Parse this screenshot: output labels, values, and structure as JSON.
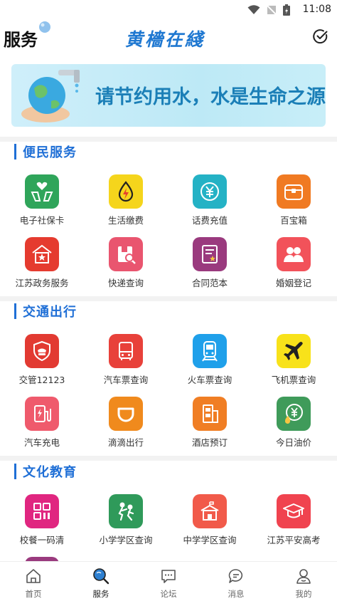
{
  "status_bar": {
    "time": "11:08"
  },
  "header": {
    "title": "服务",
    "brand": "黄檣在綫"
  },
  "banner": {
    "text": "请节约用水，水是生命之源"
  },
  "sections": [
    {
      "title": "便民服务",
      "items": [
        {
          "label": "电子社保卡",
          "color": "#2fa55a",
          "icon": "hands-heart-icon"
        },
        {
          "label": "生活缴费",
          "color": "#f5d51c",
          "icon": "lightning-drop-icon"
        },
        {
          "label": "话费充值",
          "color": "#24b2c5",
          "icon": "yuan-coin-icon"
        },
        {
          "label": "百宝箱",
          "color": "#f07a22",
          "icon": "treasure-box-icon"
        },
        {
          "label": "江苏政务服务",
          "color": "#e53b2f",
          "icon": "government-house-icon"
        },
        {
          "label": "快递查询",
          "color": "#e9556f",
          "icon": "package-search-icon"
        },
        {
          "label": "合同范本",
          "color": "#9a3a7e",
          "icon": "contract-document-icon"
        },
        {
          "label": "婚姻登记",
          "color": "#f2525a",
          "icon": "couple-icon"
        }
      ]
    },
    {
      "title": "交通出行",
      "items": [
        {
          "label": "交管12123",
          "color": "#e23a32",
          "icon": "police-shield-icon"
        },
        {
          "label": "汽车票查询",
          "color": "#e8413a",
          "icon": "bus-icon"
        },
        {
          "label": "火车票查询",
          "color": "#1fa0ea",
          "icon": "train-icon"
        },
        {
          "label": "飞机票查询",
          "color": "#f8e21a",
          "icon": "airplane-icon"
        },
        {
          "label": "汽车充电",
          "color": "#ef5a6c",
          "icon": "charging-station-icon"
        },
        {
          "label": "滴滴出行",
          "color": "#f08a1d",
          "icon": "didi-icon"
        },
        {
          "label": "酒店预订",
          "color": "#f07e24",
          "icon": "hotel-building-icon"
        },
        {
          "label": "今日油价",
          "color": "#3f9b5a",
          "icon": "oil-price-icon"
        }
      ]
    },
    {
      "title": "文化教育",
      "items": [
        {
          "label": "校餐一码清",
          "color": "#e02680",
          "icon": "qr-code-icon"
        },
        {
          "label": "小学学区查询",
          "color": "#2f9a5a",
          "icon": "kids-play-icon"
        },
        {
          "label": "中学学区查询",
          "color": "#f15a4a",
          "icon": "school-building-icon"
        },
        {
          "label": "江苏平安高考",
          "color": "#f0434f",
          "icon": "graduation-cap-icon"
        }
      ]
    }
  ],
  "bottom_nav": [
    {
      "label": "首页",
      "icon": "home-icon",
      "active": false
    },
    {
      "label": "服务",
      "icon": "search-globe-icon",
      "active": true
    },
    {
      "label": "论坛",
      "icon": "forum-icon",
      "active": false
    },
    {
      "label": "消息",
      "icon": "message-icon",
      "active": false
    },
    {
      "label": "我的",
      "icon": "profile-icon",
      "active": false
    }
  ]
}
